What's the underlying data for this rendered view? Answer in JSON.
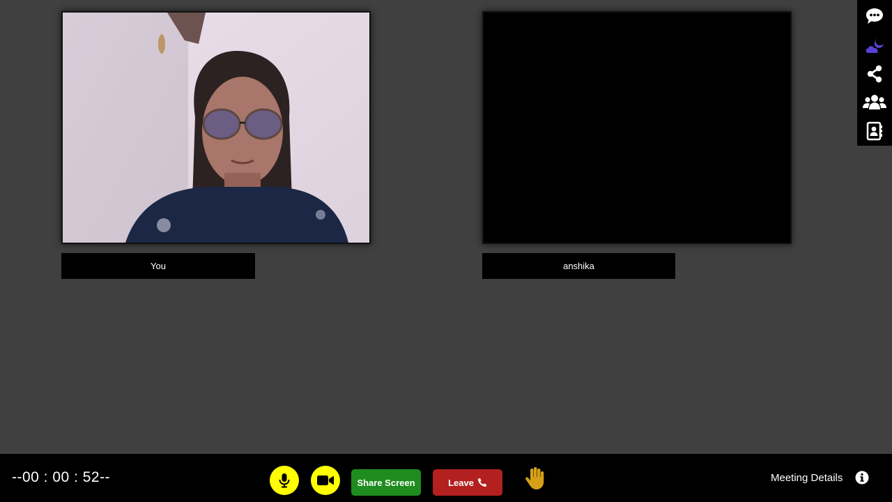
{
  "participants": {
    "self_label": "You",
    "remote_label": "anshika"
  },
  "sidebar": {
    "items": [
      {
        "icon": "chat-icon",
        "color": "#ffffff"
      },
      {
        "icon": "night-mode-icon",
        "color": "#5b3fd6"
      },
      {
        "icon": "share-icon",
        "color": "#ffffff"
      },
      {
        "icon": "participants-icon",
        "color": "#ffffff"
      },
      {
        "icon": "contacts-icon",
        "color": "#ffffff"
      }
    ]
  },
  "bottombar": {
    "timer": "--00 : 00 : 52--",
    "mic_color": "#ffff00",
    "camera_color": "#ffff00",
    "share_label": "Share Screen",
    "share_color": "#1e8c1e",
    "leave_label": "Leave",
    "leave_color": "#b32020",
    "hand_color": "#d4a017",
    "meeting_details_label": "Meeting Details"
  }
}
